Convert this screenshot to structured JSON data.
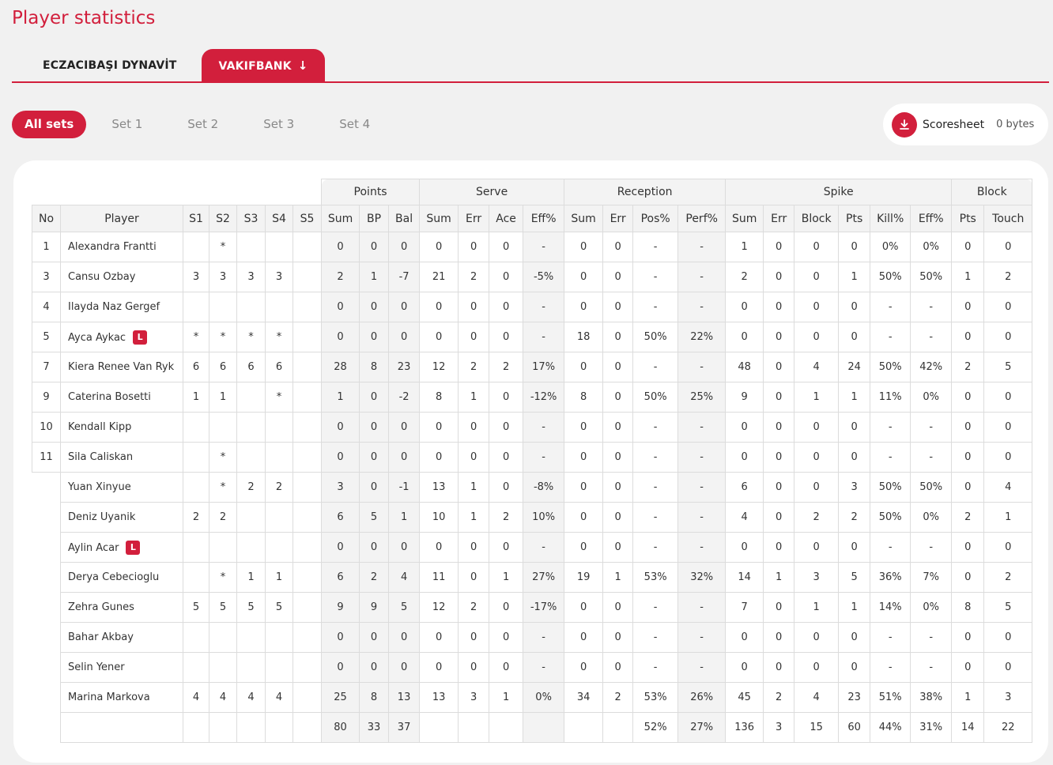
{
  "title": "Player statistics",
  "teams": [
    {
      "label": "ECZACIBAŞI DYNAVİT",
      "active": false
    },
    {
      "label": "VAKIFBANK",
      "active": true,
      "icon": "arrow-down-icon"
    }
  ],
  "sets": [
    "All sets",
    "Set 1",
    "Set 2",
    "Set 3",
    "Set 4"
  ],
  "scoresheet": {
    "label": "Scoresheet",
    "size": "0 bytes",
    "icon": "download-icon"
  },
  "libero_badge": "L",
  "colors": {
    "accent": "#d21f3c",
    "header_bg": "#f3f3f3"
  },
  "table": {
    "groups": [
      "Points",
      "Serve",
      "Reception",
      "Spike",
      "Block"
    ],
    "columns": [
      "No",
      "Player",
      "S1",
      "S2",
      "S3",
      "S4",
      "S5",
      "Sum",
      "BP",
      "Bal",
      "Sum",
      "Err",
      "Ace",
      "Eff%",
      "Sum",
      "Err",
      "Pos%",
      "Perf%",
      "Sum",
      "Err",
      "Block",
      "Pts",
      "Kill%",
      "Eff%",
      "Pts",
      "Touch"
    ],
    "rows": [
      {
        "no": "1",
        "player": "Alexandra Frantti",
        "libero": false,
        "cells": [
          "",
          "*",
          "",
          "",
          "",
          "0",
          "0",
          "0",
          "0",
          "0",
          "0",
          "-",
          "0",
          "0",
          "-",
          "-",
          "1",
          "0",
          "0",
          "0",
          "0%",
          "0%",
          "0",
          "0"
        ]
      },
      {
        "no": "3",
        "player": "Cansu Ozbay",
        "libero": false,
        "cells": [
          "3",
          "3",
          "3",
          "3",
          "",
          "2",
          "1",
          "-7",
          "21",
          "2",
          "0",
          "-5%",
          "0",
          "0",
          "-",
          "-",
          "2",
          "0",
          "0",
          "1",
          "50%",
          "50%",
          "1",
          "2"
        ]
      },
      {
        "no": "4",
        "player": "Ilayda Naz Gergef",
        "libero": false,
        "cells": [
          "",
          "",
          "",
          "",
          "",
          "0",
          "0",
          "0",
          "0",
          "0",
          "0",
          "-",
          "0",
          "0",
          "-",
          "-",
          "0",
          "0",
          "0",
          "0",
          "-",
          "-",
          "0",
          "0"
        ]
      },
      {
        "no": "5",
        "player": "Ayca Aykac",
        "libero": true,
        "cells": [
          "*",
          "*",
          "*",
          "*",
          "",
          "0",
          "0",
          "0",
          "0",
          "0",
          "0",
          "-",
          "18",
          "0",
          "50%",
          "22%",
          "0",
          "0",
          "0",
          "0",
          "-",
          "-",
          "0",
          "0"
        ]
      },
      {
        "no": "7",
        "player": "Kiera Renee Van Ryk",
        "libero": false,
        "cells": [
          "6",
          "6",
          "6",
          "6",
          "",
          "28",
          "8",
          "23",
          "12",
          "2",
          "2",
          "17%",
          "0",
          "0",
          "-",
          "-",
          "48",
          "0",
          "4",
          "24",
          "50%",
          "42%",
          "2",
          "5"
        ]
      },
      {
        "no": "9",
        "player": "Caterina Bosetti",
        "libero": false,
        "cells": [
          "1",
          "1",
          "",
          "*",
          "",
          "1",
          "0",
          "-2",
          "8",
          "1",
          "0",
          "-12%",
          "8",
          "0",
          "50%",
          "25%",
          "9",
          "0",
          "1",
          "1",
          "11%",
          "0%",
          "0",
          "0"
        ]
      },
      {
        "no": "10",
        "player": "Kendall Kipp",
        "libero": false,
        "cells": [
          "",
          "",
          "",
          "",
          "",
          "0",
          "0",
          "0",
          "0",
          "0",
          "0",
          "-",
          "0",
          "0",
          "-",
          "-",
          "0",
          "0",
          "0",
          "0",
          "-",
          "-",
          "0",
          "0"
        ]
      },
      {
        "no": "11",
        "player": "Sila Caliskan",
        "libero": false,
        "cells": [
          "",
          "*",
          "",
          "",
          "",
          "0",
          "0",
          "0",
          "0",
          "0",
          "0",
          "-",
          "0",
          "0",
          "-",
          "-",
          "0",
          "0",
          "0",
          "0",
          "-",
          "-",
          "0",
          "0"
        ]
      },
      {
        "no": "",
        "player": "Yuan Xinyue",
        "libero": false,
        "cells": [
          "",
          "*",
          "2",
          "2",
          "",
          "3",
          "0",
          "-1",
          "13",
          "1",
          "0",
          "-8%",
          "0",
          "0",
          "-",
          "-",
          "6",
          "0",
          "0",
          "3",
          "50%",
          "50%",
          "0",
          "4"
        ]
      },
      {
        "no": "",
        "player": "Deniz Uyanik",
        "libero": false,
        "cells": [
          "2",
          "2",
          "",
          "",
          "",
          "6",
          "5",
          "1",
          "10",
          "1",
          "2",
          "10%",
          "0",
          "0",
          "-",
          "-",
          "4",
          "0",
          "2",
          "2",
          "50%",
          "0%",
          "2",
          "1"
        ]
      },
      {
        "no": "",
        "player": "Aylin Acar",
        "libero": true,
        "cells": [
          "",
          "",
          "",
          "",
          "",
          "0",
          "0",
          "0",
          "0",
          "0",
          "0",
          "-",
          "0",
          "0",
          "-",
          "-",
          "0",
          "0",
          "0",
          "0",
          "-",
          "-",
          "0",
          "0"
        ]
      },
      {
        "no": "",
        "player": "Derya Cebecioglu",
        "libero": false,
        "cells": [
          "",
          "*",
          "1",
          "1",
          "",
          "6",
          "2",
          "4",
          "11",
          "0",
          "1",
          "27%",
          "19",
          "1",
          "53%",
          "32%",
          "14",
          "1",
          "3",
          "5",
          "36%",
          "7%",
          "0",
          "2"
        ]
      },
      {
        "no": "",
        "player": "Zehra Gunes",
        "libero": false,
        "cells": [
          "5",
          "5",
          "5",
          "5",
          "",
          "9",
          "9",
          "5",
          "12",
          "2",
          "0",
          "-17%",
          "0",
          "0",
          "-",
          "-",
          "7",
          "0",
          "1",
          "1",
          "14%",
          "0%",
          "8",
          "5"
        ]
      },
      {
        "no": "",
        "player": "Bahar Akbay",
        "libero": false,
        "cells": [
          "",
          "",
          "",
          "",
          "",
          "0",
          "0",
          "0",
          "0",
          "0",
          "0",
          "-",
          "0",
          "0",
          "-",
          "-",
          "0",
          "0",
          "0",
          "0",
          "-",
          "-",
          "0",
          "0"
        ]
      },
      {
        "no": "",
        "player": "Selin Yener",
        "libero": false,
        "cells": [
          "",
          "",
          "",
          "",
          "",
          "0",
          "0",
          "0",
          "0",
          "0",
          "0",
          "-",
          "0",
          "0",
          "-",
          "-",
          "0",
          "0",
          "0",
          "0",
          "-",
          "-",
          "0",
          "0"
        ]
      },
      {
        "no": "",
        "player": "Marina Markova",
        "libero": false,
        "cells": [
          "4",
          "4",
          "4",
          "4",
          "",
          "25",
          "8",
          "13",
          "13",
          "3",
          "1",
          "0%",
          "34",
          "2",
          "53%",
          "26%",
          "45",
          "2",
          "4",
          "23",
          "51%",
          "38%",
          "1",
          "3"
        ]
      }
    ],
    "totals": [
      "",
      "",
      "",
      "",
      "",
      "",
      "80",
      "33",
      "37",
      "",
      "",
      "",
      "",
      "",
      "",
      "52%",
      "27%",
      "136",
      "3",
      "15",
      "60",
      "44%",
      "31%",
      "14",
      "22"
    ]
  }
}
